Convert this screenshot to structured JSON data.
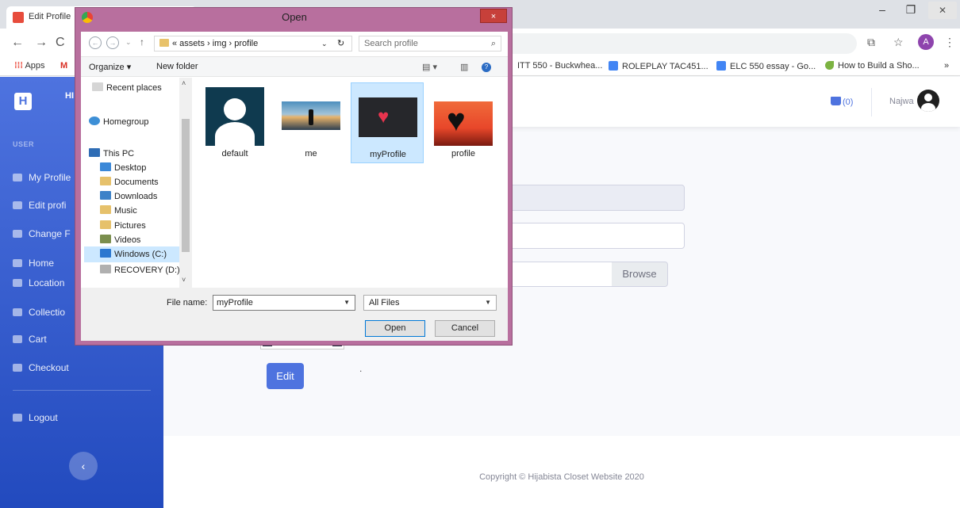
{
  "browser": {
    "tab_title": "Edit Profile",
    "bookmarks": [
      {
        "label": "Apps"
      },
      {
        "label": "ITT 550 - Buckwhea..."
      },
      {
        "label": "ROLEPLAY TAC451..."
      },
      {
        "label": "ELC 550 essay - Go..."
      },
      {
        "label": "How to Build a Sho..."
      }
    ],
    "more_bookmarks": "»",
    "profile_initial": "A"
  },
  "sidebar": {
    "brand_letter": "H",
    "brand_partial": "HI",
    "heading": "USER",
    "items": [
      {
        "label": "My Profile",
        "icon": "user-icon"
      },
      {
        "label": "Edit profi",
        "icon": "user-edit-icon"
      },
      {
        "label": "Change F",
        "icon": "key-icon"
      },
      {
        "label": "Home",
        "icon": "home-icon"
      },
      {
        "label": "Location",
        "icon": "map-icon"
      },
      {
        "label": "Collectio",
        "icon": "collection-icon"
      },
      {
        "label": "Cart",
        "icon": "cart-icon"
      },
      {
        "label": "Checkout",
        "icon": "checkout-icon"
      }
    ],
    "logout": "Logout",
    "toggle": "‹"
  },
  "topbar": {
    "cart": "(0)",
    "user_name": "Najwa"
  },
  "form": {
    "browse": "Browse",
    "submit": "Edit",
    "dot": "."
  },
  "footer": {
    "copyright": "Copyright © Hijabista Closet Website 2020"
  },
  "dialog": {
    "title": "Open",
    "close": "×",
    "breadcrumb": "« assets › img › profile",
    "search_placeholder": "Search profile",
    "organize": "Organize ▾",
    "new_folder": "New folder",
    "nav": [
      {
        "label": "Recent places"
      },
      {
        "label": "Homegroup"
      },
      {
        "label": "This PC"
      },
      {
        "label": "Desktop"
      },
      {
        "label": "Documents"
      },
      {
        "label": "Downloads"
      },
      {
        "label": "Music"
      },
      {
        "label": "Pictures"
      },
      {
        "label": "Videos"
      },
      {
        "label": "Windows (C:)"
      },
      {
        "label": "RECOVERY (D:)"
      }
    ],
    "files": [
      {
        "name": "default"
      },
      {
        "name": "me"
      },
      {
        "name": "myProfile"
      },
      {
        "name": "profile"
      }
    ],
    "file_name_label": "File name:",
    "file_name_value": "myProfile",
    "file_type": "All Files",
    "open_button": "Open",
    "cancel_button": "Cancel"
  },
  "colors": {
    "sidebar_top": "#4e73df",
    "sidebar_bottom": "#224abe",
    "dialog_frame": "#b86f9e",
    "selection": "#cce8ff"
  }
}
